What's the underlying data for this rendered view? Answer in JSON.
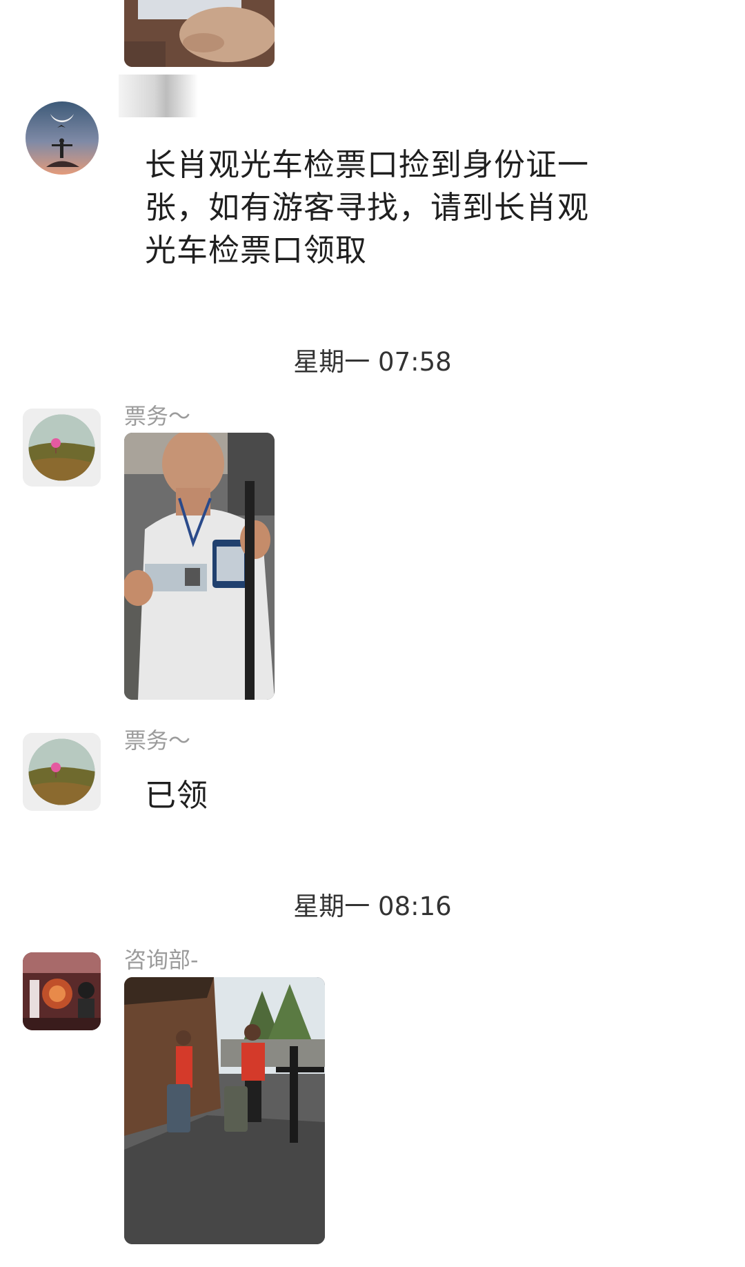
{
  "messages": [
    {
      "sender": "",
      "text": "长肖观光车检票口捡到身份证一张，如有游客寻找，请到长肖观光车检票口领取",
      "lines": [
        "长肖观光车检票口捡到身份证一",
        "张，如有游客寻找，请到长肖观",
        "光车检票口领取"
      ]
    },
    {
      "sender": "票务～",
      "image": "photo-staff-holding-id-card"
    },
    {
      "sender": "票务～",
      "text": "已领"
    },
    {
      "sender": "咨询部-",
      "image": "photo-staff-carrying-suitcases"
    }
  ],
  "timestamps": [
    "星期一 07:58",
    "星期一 08:16"
  ],
  "colors": {
    "background": "#ffffff",
    "text": "#1f1f1f",
    "sender": "#9b9b9b",
    "timestamp": "#333333"
  }
}
